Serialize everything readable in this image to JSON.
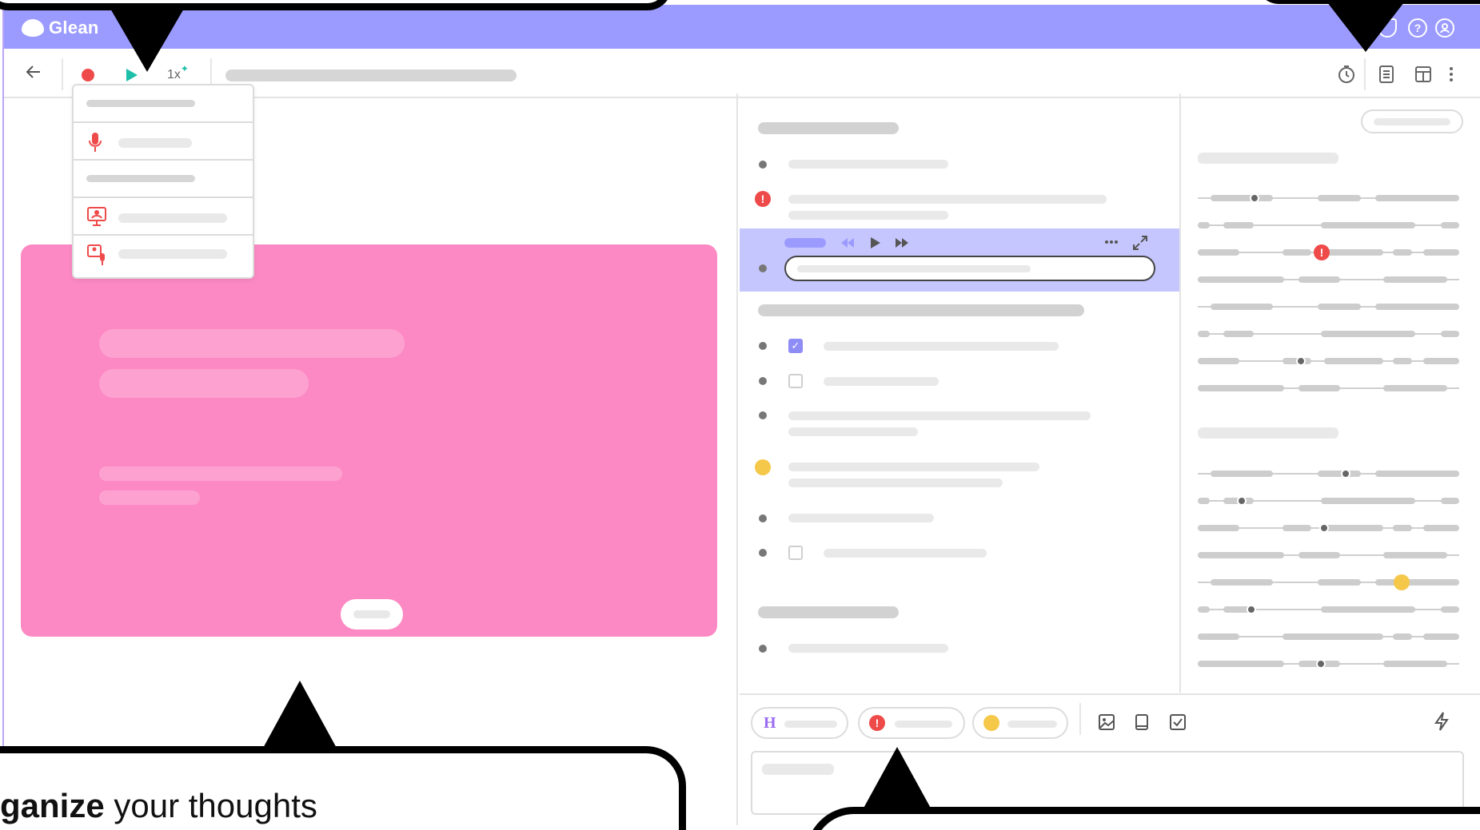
{
  "app": {
    "brand": "Glean",
    "speed_label": "1x",
    "colors": {
      "titlebar": "#9b9bff",
      "accent_pink": "#fc89c3",
      "highlight": "#c6c6ff",
      "alert": "#ef4a4a",
      "record": "#ef4a4a",
      "play": "#1dbfa8"
    }
  },
  "toolbar": {
    "back_icon": "arrow-left-icon",
    "record_icon": "record-icon",
    "play_icon": "play-icon",
    "speed_icon": "speed-icon",
    "right_icons": [
      "timer-icon",
      "notes-icon",
      "layout-icon",
      "more-vertical-icon"
    ]
  },
  "titlebar": {
    "icons": [
      "cloud-icon",
      "help-icon",
      "account-icon"
    ]
  },
  "dropdown": {
    "icons": [
      "microphone-icon",
      "screen-presenter-icon",
      "screen-audio-icon"
    ]
  },
  "composer": {
    "chip_h_label": "H",
    "icons": [
      "image-icon",
      "book-icon",
      "checkbox-icon",
      "lightning-icon"
    ]
  },
  "callout": {
    "bold": "ganize",
    "rest": " your thoughts"
  }
}
